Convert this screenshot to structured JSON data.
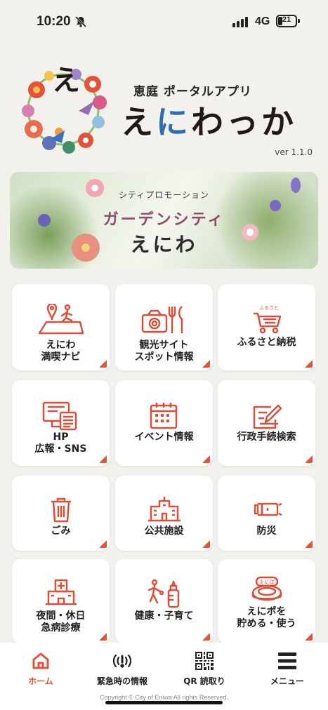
{
  "status": {
    "time": "10:20",
    "network": "4G",
    "battery": "21"
  },
  "header": {
    "subtitle": "恵庭 ポータルアプリ",
    "name_a": "え",
    "name_b": "に",
    "name_c": "わっか",
    "logo_char": "え",
    "version": "ver 1.1.0"
  },
  "banner": {
    "small": "シティプロモーション",
    "title1": "ガーデンシティ",
    "title2": "えにわ"
  },
  "tiles": [
    {
      "label": "えにわ\n満喫ナビ",
      "icon": "map-walk-icon"
    },
    {
      "label": "観光サイト\nスポット情報",
      "icon": "camera-dining-icon"
    },
    {
      "label": "ふるさと納税",
      "icon": "furusato-cart-icon"
    },
    {
      "label": "HP\n広報・SNS",
      "icon": "monitor-document-icon"
    },
    {
      "label": "イベント情報",
      "icon": "calendar-icon"
    },
    {
      "label": "行政手続検索",
      "icon": "form-pen-icon"
    },
    {
      "label": "ごみ",
      "icon": "trash-icon"
    },
    {
      "label": "公共施設",
      "icon": "building-icon"
    },
    {
      "label": "防災",
      "icon": "flashlight-icon"
    },
    {
      "label": "夜間・休日\n急病診療",
      "icon": "hospital-icon"
    },
    {
      "label": "健康・子育て",
      "icon": "family-bottle-icon"
    },
    {
      "label": "えにポを\n貯める・使う",
      "icon": "enipo-coin-icon",
      "badge": "えにぽ"
    }
  ],
  "tabs": [
    {
      "label": "ホーム",
      "icon": "home-icon",
      "active": true
    },
    {
      "label": "緊急時の情報",
      "icon": "emergency-broadcast-icon",
      "active": false
    },
    {
      "label": "QR 読取り",
      "icon": "qr-code-icon",
      "active": false
    },
    {
      "label": "メニュー",
      "icon": "hamburger-menu-icon",
      "active": false
    }
  ],
  "copyright": "Copyright © City of Eniwa All rights Reserved.",
  "colors": {
    "accent": "#e3523a",
    "background": "#f3f1ec",
    "icon_stroke": "#d9503a"
  }
}
